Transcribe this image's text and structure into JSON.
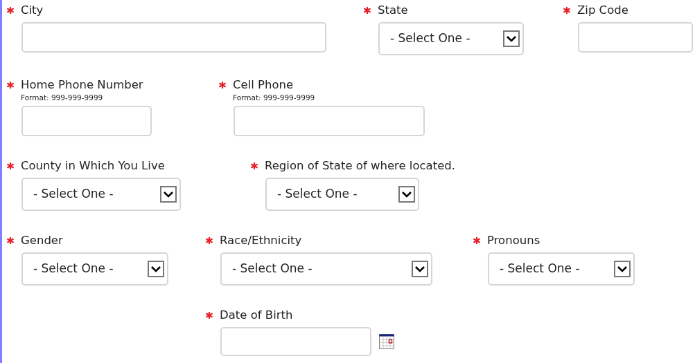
{
  "rows": [
    {
      "fields": [
        {
          "kind": "text",
          "label": "City",
          "required": true
        },
        {
          "kind": "select",
          "label": "State",
          "required": true,
          "value": "- Select One -"
        },
        {
          "kind": "text",
          "label": "Zip Code",
          "required": true
        }
      ]
    },
    {
      "fields": [
        {
          "kind": "text",
          "label": "Home Phone Number",
          "hint": "Format: 999-999-9999",
          "required": true
        },
        {
          "kind": "text",
          "label": "Cell Phone",
          "hint": "Format: 999-999-9999",
          "required": true
        }
      ]
    },
    {
      "fields": [
        {
          "kind": "select",
          "label": "County in Which You Live",
          "required": true,
          "value": "- Select One -"
        },
        {
          "kind": "select",
          "label": "Region of State of where located.",
          "required": true,
          "value": "- Select One -"
        }
      ]
    },
    {
      "fields": [
        {
          "kind": "select",
          "label": "Gender",
          "required": true,
          "value": "- Select One -"
        },
        {
          "kind": "select",
          "label": "Race/Ethnicity",
          "required": true,
          "value": "- Select One -"
        },
        {
          "kind": "select",
          "label": "Pronouns",
          "required": true,
          "value": "- Select One -"
        }
      ]
    },
    {
      "fields": [
        {
          "kind": "date",
          "label": "Date of Birth",
          "required": true
        }
      ]
    }
  ]
}
